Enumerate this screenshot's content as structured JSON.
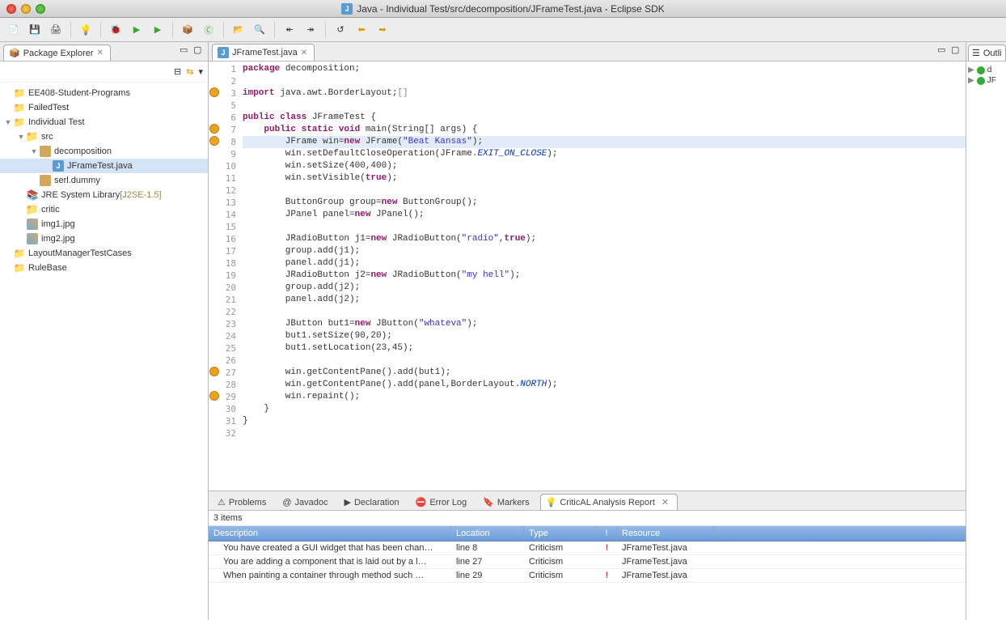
{
  "window": {
    "title": "Java - Individual Test/src/decomposition/JFrameTest.java - Eclipse SDK"
  },
  "package_explorer": {
    "title": "Package Explorer",
    "projects": [
      {
        "name": "EE408-Student-Programs",
        "expanded": false
      },
      {
        "name": "FailedTest",
        "expanded": false
      },
      {
        "name": "Individual Test",
        "expanded": true,
        "children": [
          {
            "name": "src",
            "type": "srcfolder",
            "expanded": true,
            "children": [
              {
                "name": "decomposition",
                "type": "package",
                "expanded": true,
                "children": [
                  {
                    "name": "JFrameTest.java",
                    "type": "java",
                    "selected": true
                  }
                ]
              },
              {
                "name": "serl.dummy",
                "type": "package"
              }
            ]
          },
          {
            "name": "JRE System Library",
            "suffix": "[J2SE-1.5]",
            "type": "jar"
          },
          {
            "name": "critic",
            "type": "folder"
          },
          {
            "name": "img1.jpg",
            "type": "image"
          },
          {
            "name": "img2.jpg",
            "type": "image"
          }
        ]
      },
      {
        "name": "LayoutManagerTestCases",
        "expanded": false
      },
      {
        "name": "RuleBase",
        "expanded": false
      }
    ]
  },
  "editor": {
    "tab": "JFrameTest.java",
    "highlighted_line": 8,
    "annotations": [
      3,
      7,
      8,
      27,
      29
    ],
    "lines": [
      {
        "n": 1,
        "seg": [
          {
            "t": "package ",
            "c": "kw"
          },
          {
            "t": "decomposition;"
          }
        ]
      },
      {
        "n": 2,
        "seg": []
      },
      {
        "n": 3,
        "seg": [
          {
            "t": "import ",
            "c": "kw"
          },
          {
            "t": "java.awt.BorderLayout;"
          },
          {
            "t": "[]",
            "c": "cm"
          }
        ]
      },
      {
        "n": 5,
        "seg": []
      },
      {
        "n": 6,
        "seg": [
          {
            "t": "public class ",
            "c": "kw"
          },
          {
            "t": "JFrameTest {"
          }
        ]
      },
      {
        "n": 7,
        "seg": [
          {
            "t": "    "
          },
          {
            "t": "public static void ",
            "c": "kw"
          },
          {
            "t": "main(String[] args) {"
          }
        ]
      },
      {
        "n": 8,
        "seg": [
          {
            "t": "        JFrame win="
          },
          {
            "t": "new ",
            "c": "kw"
          },
          {
            "t": "JFrame("
          },
          {
            "t": "\"Beat Kansas\"",
            "c": "str"
          },
          {
            "t": ");"
          }
        ]
      },
      {
        "n": 9,
        "seg": [
          {
            "t": "        win.setDefaultCloseOperation(JFrame."
          },
          {
            "t": "EXIT_ON_CLOSE",
            "c": "fld"
          },
          {
            "t": ");"
          }
        ]
      },
      {
        "n": 10,
        "seg": [
          {
            "t": "        win.setSize(400,400);"
          }
        ]
      },
      {
        "n": 11,
        "seg": [
          {
            "t": "        win.setVisible("
          },
          {
            "t": "true",
            "c": "kw"
          },
          {
            "t": ");"
          }
        ]
      },
      {
        "n": 12,
        "seg": []
      },
      {
        "n": 13,
        "seg": [
          {
            "t": "        ButtonGroup group="
          },
          {
            "t": "new ",
            "c": "kw"
          },
          {
            "t": "ButtonGroup();"
          }
        ]
      },
      {
        "n": 14,
        "seg": [
          {
            "t": "        JPanel panel="
          },
          {
            "t": "new ",
            "c": "kw"
          },
          {
            "t": "JPanel();"
          }
        ]
      },
      {
        "n": 15,
        "seg": []
      },
      {
        "n": 16,
        "seg": [
          {
            "t": "        JRadioButton j1="
          },
          {
            "t": "new ",
            "c": "kw"
          },
          {
            "t": "JRadioButton("
          },
          {
            "t": "\"radio\"",
            "c": "str"
          },
          {
            "t": ","
          },
          {
            "t": "true",
            "c": "kw"
          },
          {
            "t": ");"
          }
        ]
      },
      {
        "n": 17,
        "seg": [
          {
            "t": "        group.add(j1);"
          }
        ]
      },
      {
        "n": 18,
        "seg": [
          {
            "t": "        panel.add(j1);"
          }
        ]
      },
      {
        "n": 19,
        "seg": [
          {
            "t": "        JRadioButton j2="
          },
          {
            "t": "new ",
            "c": "kw"
          },
          {
            "t": "JRadioButton("
          },
          {
            "t": "\"my hell\"",
            "c": "str"
          },
          {
            "t": ");"
          }
        ]
      },
      {
        "n": 20,
        "seg": [
          {
            "t": "        group.add(j2);"
          }
        ]
      },
      {
        "n": 21,
        "seg": [
          {
            "t": "        panel.add(j2);"
          }
        ]
      },
      {
        "n": 22,
        "seg": []
      },
      {
        "n": 23,
        "seg": [
          {
            "t": "        JButton but1="
          },
          {
            "t": "new ",
            "c": "kw"
          },
          {
            "t": "JButton("
          },
          {
            "t": "\"whateva\"",
            "c": "str"
          },
          {
            "t": ");"
          }
        ]
      },
      {
        "n": 24,
        "seg": [
          {
            "t": "        but1.setSize(90,20);"
          }
        ]
      },
      {
        "n": 25,
        "seg": [
          {
            "t": "        but1.setLocation(23,45);"
          }
        ]
      },
      {
        "n": 26,
        "seg": []
      },
      {
        "n": 27,
        "seg": [
          {
            "t": "        win.getContentPane().add(but1);"
          }
        ]
      },
      {
        "n": 28,
        "seg": [
          {
            "t": "        win.getContentPane().add(panel,BorderLayout."
          },
          {
            "t": "NORTH",
            "c": "fld"
          },
          {
            "t": ");"
          }
        ]
      },
      {
        "n": 29,
        "seg": [
          {
            "t": "        win.repaint();"
          }
        ]
      },
      {
        "n": 30,
        "seg": [
          {
            "t": "    }"
          }
        ]
      },
      {
        "n": 31,
        "seg": [
          {
            "t": "}"
          }
        ]
      },
      {
        "n": 32,
        "seg": []
      }
    ]
  },
  "bottom": {
    "tabs": [
      "Problems",
      "Javadoc",
      "Declaration",
      "Error Log",
      "Markers",
      "CriticAL Analysis Report"
    ],
    "active": 5,
    "items_label": "3 items",
    "columns": [
      "Description",
      "Location",
      "Type",
      "!",
      "Resource"
    ],
    "rows": [
      {
        "desc": "You have created a GUI widget that has been chan…",
        "loc": "line 8",
        "type": "Criticism",
        "bang": "!",
        "res": "JFrameTest.java"
      },
      {
        "desc": "You are adding a component that is laid out by a l…",
        "loc": "line 27",
        "type": "Criticism",
        "bang": "",
        "res": "JFrameTest.java"
      },
      {
        "desc": "When painting a container through method such …",
        "loc": "line 29",
        "type": "Criticism",
        "bang": "!",
        "res": "JFrameTest.java"
      }
    ]
  },
  "outline": {
    "title": "Outli",
    "items": [
      "d",
      "JF"
    ]
  }
}
